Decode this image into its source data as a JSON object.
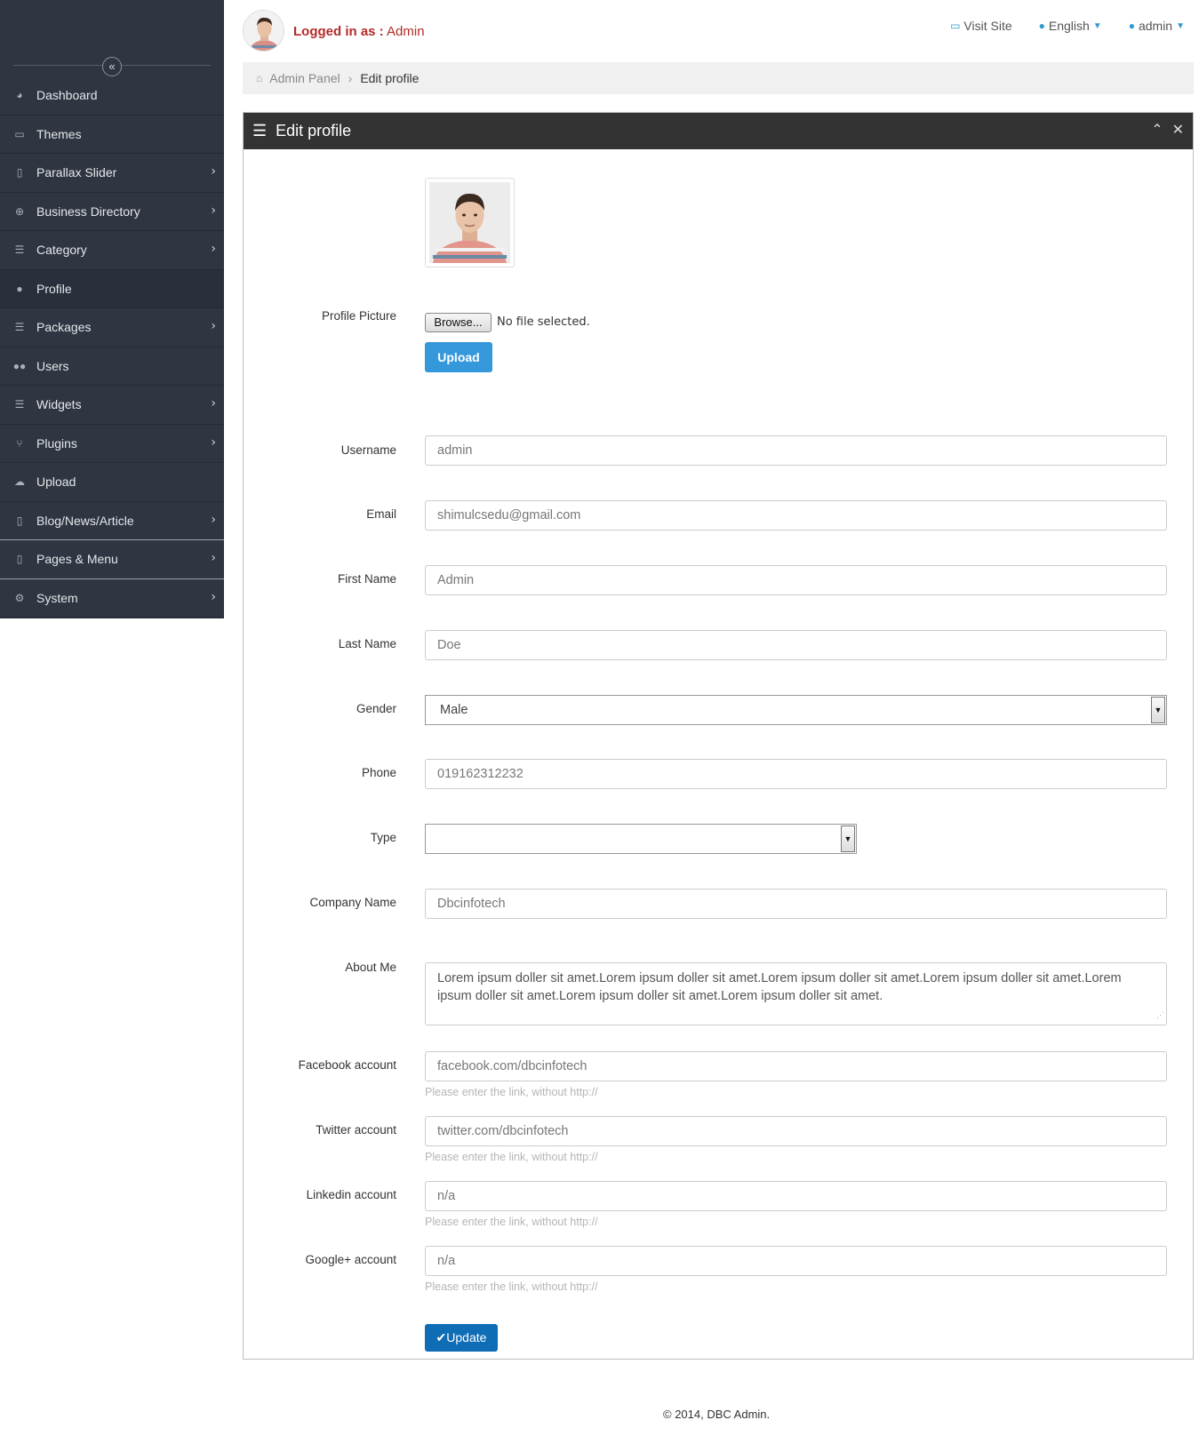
{
  "sidebar": {
    "collapse_icon": "double-chevron-left-icon",
    "items": [
      {
        "label": "Dashboard",
        "icon": "dashboard-icon",
        "has_children": false
      },
      {
        "label": "Themes",
        "icon": "monitor-icon",
        "has_children": false
      },
      {
        "label": "Parallax Slider",
        "icon": "file-icon",
        "has_children": true
      },
      {
        "label": "Business Directory",
        "icon": "plus-circle-icon",
        "has_children": true
      },
      {
        "label": "Category",
        "icon": "list-icon",
        "has_children": true
      },
      {
        "label": "Profile",
        "icon": "user-icon",
        "has_children": false,
        "active": true
      },
      {
        "label": "Packages",
        "icon": "list-icon",
        "has_children": true
      },
      {
        "label": "Users",
        "icon": "users-icon",
        "has_children": false
      },
      {
        "label": "Widgets",
        "icon": "list-icon",
        "has_children": true
      },
      {
        "label": "Plugins",
        "icon": "plug-icon",
        "has_children": true
      },
      {
        "label": "Upload",
        "icon": "cloud-upload-icon",
        "has_children": false
      },
      {
        "label": "Blog/News/Article",
        "icon": "file-icon",
        "has_children": true
      },
      {
        "label": "Pages & Menu",
        "icon": "file-icon",
        "has_children": true
      },
      {
        "label": "System",
        "icon": "gear-icon",
        "has_children": true
      }
    ]
  },
  "header": {
    "logged_in_label": "Logged in as :",
    "logged_in_user": "Admin",
    "visit_site": "Visit Site",
    "language": "English",
    "user_menu": "admin"
  },
  "breadcrumb": {
    "root": "Admin Panel",
    "current": "Edit profile"
  },
  "panel": {
    "title": "Edit profile"
  },
  "form": {
    "profile_picture_label": "Profile Picture",
    "browse_label": "Browse...",
    "no_file_text": "No file selected.",
    "upload_label": "Upload",
    "username_label": "Username",
    "username_value": "admin",
    "email_label": "Email",
    "email_value": "shimulcsedu@gmail.com",
    "first_name_label": "First Name",
    "first_name_value": "Admin",
    "last_name_label": "Last Name",
    "last_name_value": "Doe",
    "gender_label": "Gender",
    "gender_value": "Male",
    "phone_label": "Phone",
    "phone_value": "019162312232",
    "type_label": "Type",
    "type_value": "",
    "company_label": "Company Name",
    "company_value": "Dbcinfotech",
    "about_label": "About Me",
    "about_value": "Lorem ipsum doller sit amet.Lorem ipsum doller sit amet.Lorem ipsum doller sit amet.Lorem ipsum doller sit amet.Lorem ipsum doller sit amet.Lorem ipsum doller sit amet.Lorem ipsum doller sit amet.",
    "facebook_label": "Facebook account",
    "facebook_value": "facebook.com/dbcinfotech",
    "twitter_label": "Twitter account",
    "twitter_value": "twitter.com/dbcinfotech",
    "linkedin_label": "Linkedin account",
    "linkedin_value": "n/a",
    "google_label": "Google+ account",
    "google_value": "n/a",
    "link_help": "Please enter the link, without http://",
    "update_label": "Update"
  },
  "footer": {
    "text": "© 2014, DBC Admin."
  },
  "colors": {
    "sidebar_bg": "#2f3541",
    "accent_blue": "#3498db",
    "update_blue": "#0f6db5",
    "logged_red": "#b22b27",
    "panel_head": "#333333"
  }
}
